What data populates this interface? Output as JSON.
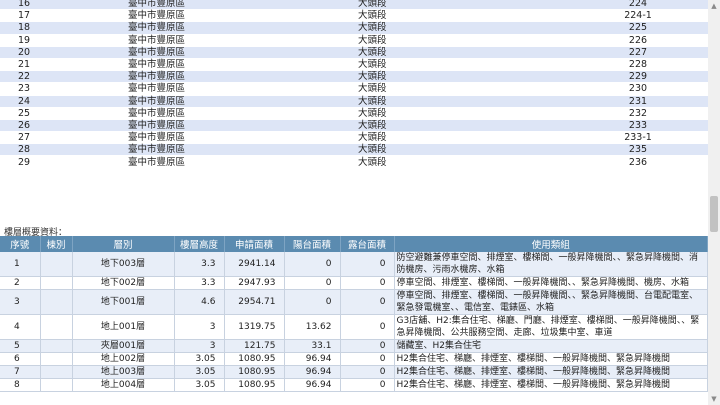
{
  "parcels": [
    {
      "no": "16",
      "district": "臺中市豐原區",
      "section": "大頭段",
      "lot": "224"
    },
    {
      "no": "17",
      "district": "臺中市豐原區",
      "section": "大頭段",
      "lot": "224-1"
    },
    {
      "no": "18",
      "district": "臺中市豐原區",
      "section": "大頭段",
      "lot": "225"
    },
    {
      "no": "19",
      "district": "臺中市豐原區",
      "section": "大頭段",
      "lot": "226"
    },
    {
      "no": "20",
      "district": "臺中市豐原區",
      "section": "大頭段",
      "lot": "227"
    },
    {
      "no": "21",
      "district": "臺中市豐原區",
      "section": "大頭段",
      "lot": "228"
    },
    {
      "no": "22",
      "district": "臺中市豐原區",
      "section": "大頭段",
      "lot": "229"
    },
    {
      "no": "23",
      "district": "臺中市豐原區",
      "section": "大頭段",
      "lot": "230"
    },
    {
      "no": "24",
      "district": "臺中市豐原區",
      "section": "大頭段",
      "lot": "231"
    },
    {
      "no": "25",
      "district": "臺中市豐原區",
      "section": "大頭段",
      "lot": "232"
    },
    {
      "no": "26",
      "district": "臺中市豐原區",
      "section": "大頭段",
      "lot": "233"
    },
    {
      "no": "27",
      "district": "臺中市豐原區",
      "section": "大頭段",
      "lot": "233-1"
    },
    {
      "no": "28",
      "district": "臺中市豐原區",
      "section": "大頭段",
      "lot": "235"
    },
    {
      "no": "29",
      "district": "臺中市豐原區",
      "section": "大頭段",
      "lot": "236"
    }
  ],
  "summary_label": "樓層概要資料：",
  "floor_headers": [
    "序號",
    "棟別",
    "層別",
    "樓層高度",
    "申請面積",
    "陽台面積",
    "露台面積",
    "使用類組"
  ],
  "floors": [
    {
      "seq": "1",
      "building": "",
      "floor": "地下003層",
      "height": "3.3",
      "area": "2941.14",
      "balcony": "0",
      "terrace": "0",
      "usage": "防空避難兼停車空間、排煙室、樓梯間、一般昇降機間、、緊急昇降機間、消防機房、污雨水機房、水箱"
    },
    {
      "seq": "2",
      "building": "",
      "floor": "地下002層",
      "height": "3.3",
      "area": "2947.93",
      "balcony": "0",
      "terrace": "0",
      "usage": "停車空間、排煙室、樓梯間、一般昇降機間、、緊急昇降機間、機房、水箱"
    },
    {
      "seq": "3",
      "building": "",
      "floor": "地下001層",
      "height": "4.6",
      "area": "2954.71",
      "balcony": "0",
      "terrace": "0",
      "usage": "停車空間、排煙室、樓梯間、一般昇降機間、、緊急昇降機間、台電配電室、緊急發電機室、、電信室、電錶區、水箱"
    },
    {
      "seq": "4",
      "building": "",
      "floor": "地上001層",
      "height": "3",
      "area": "1319.75",
      "balcony": "13.62",
      "terrace": "0",
      "usage": "G3店舖、H2:集合住宅、梯廳、門廳、排煙室、樓梯間、一般昇降機間、、緊急昇降機間、公共服務空間、走廊、垃圾集中室、車道"
    },
    {
      "seq": "5",
      "building": "",
      "floor": "夾層001層",
      "height": "3",
      "area": "121.75",
      "balcony": "33.1",
      "terrace": "0",
      "usage": "儲藏室、H2集合住宅"
    },
    {
      "seq": "6",
      "building": "",
      "floor": "地上002層",
      "height": "3.05",
      "area": "1080.95",
      "balcony": "96.94",
      "terrace": "0",
      "usage": "H2集合住宅、梯廳、排煙室、樓梯間、一般昇降機間、緊急昇降機間"
    },
    {
      "seq": "7",
      "building": "",
      "floor": "地上003層",
      "height": "3.05",
      "area": "1080.95",
      "balcony": "96.94",
      "terrace": "0",
      "usage": "H2集合住宅、梯廳、排煙室、樓梯間、一般昇降機間、緊急昇降機間"
    },
    {
      "seq": "8",
      "building": "",
      "floor": "地上004層",
      "height": "3.05",
      "area": "1080.95",
      "balcony": "96.94",
      "terrace": "0",
      "usage": "H2集合住宅、梯廳、排煙室、樓梯間、一般昇降機間、緊急昇降機間"
    }
  ]
}
